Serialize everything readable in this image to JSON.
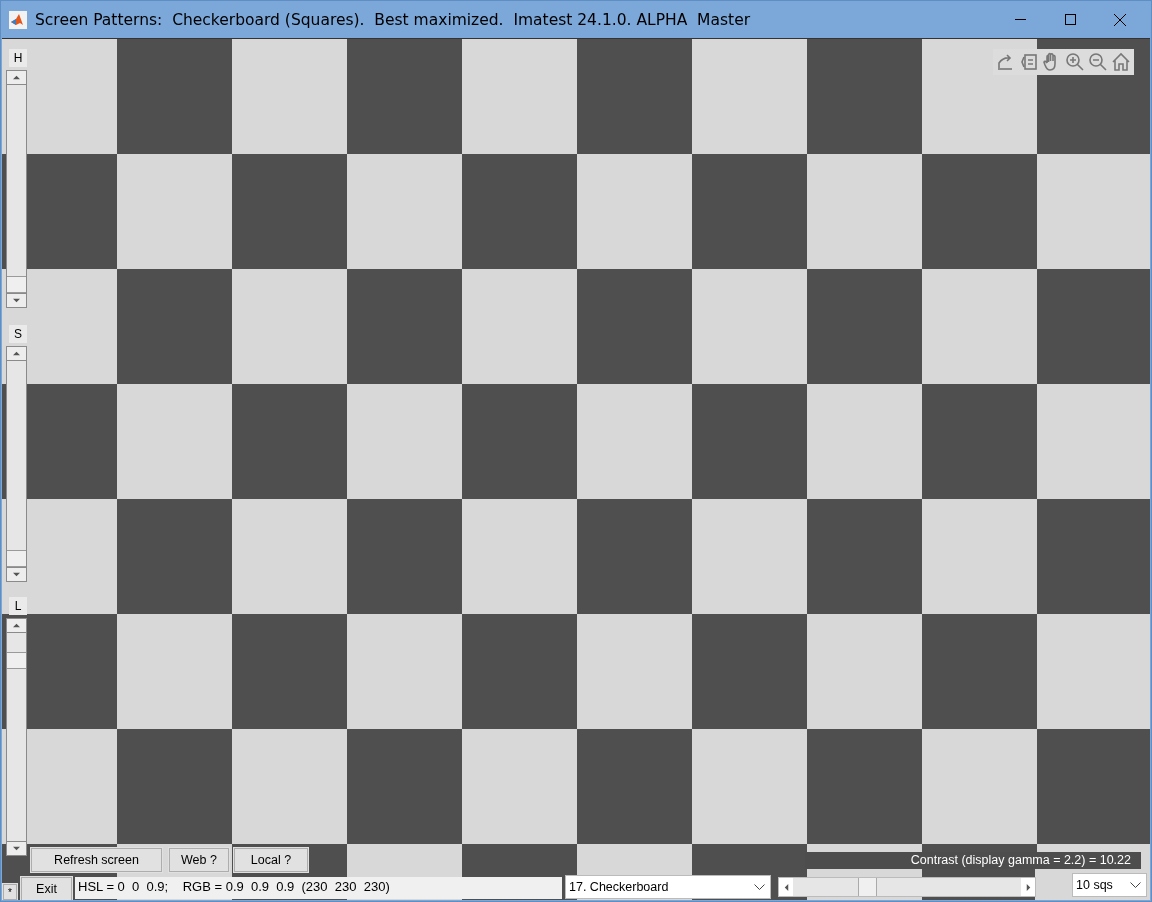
{
  "window": {
    "title": "Screen Patterns:  Checkerboard (Squares).  Best maximized.  Imatest 24.1.0. ALPHA  Master"
  },
  "sliders": [
    {
      "label": "H",
      "level": 0
    },
    {
      "label": "S",
      "level": 0
    },
    {
      "label": "L",
      "level": 0.9
    }
  ],
  "buttons": [
    {
      "label": "Refresh screen"
    },
    {
      "label": "Web ?"
    },
    {
      "label": "Local ?"
    }
  ],
  "exit_button": {
    "label": "Exit"
  },
  "corner_button": {
    "label": "*"
  },
  "status": {
    "value": "HSL = 0  0  0.9;    RGB = 0.9  0.9  0.9  (230  230  230)"
  },
  "pattern_select": {
    "value": "17. Checkerboard"
  },
  "contrast": {
    "text": "Contrast (display gamma = 2.2) = 10.22"
  },
  "size_slider": {
    "level": 0.31
  },
  "size_select": {
    "value": "10 sqs"
  }
}
